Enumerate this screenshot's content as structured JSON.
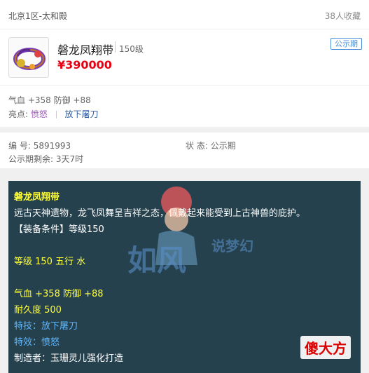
{
  "header": {
    "server": "北京1区-太和殿",
    "favorites": "38人收藏"
  },
  "item": {
    "name": "磐龙凤翔带",
    "level": "150级",
    "price": "¥390000",
    "status_badge": "公示期",
    "attributes": "气血 +358 防御 +88",
    "shine_label": "亮点:",
    "shine_1": "愤怒",
    "shine_2": "放下屠刀"
  },
  "meta": {
    "id_label": "编 号:",
    "id_value": "5891993",
    "status_label": "状 态:",
    "status_value": "公示期",
    "remaining_label": "公示期剩余:",
    "remaining_value": "3天7时"
  },
  "desc": {
    "title": "磐龙凤翔带",
    "flavor": "远古天神遗物，龙飞凤舞呈吉祥之态，佩戴起来能受到上古神兽的庇护。",
    "requirement": "【装备条件】等级150",
    "level_element": "等级 150  五行 水",
    "stats": "气血 +358  防御 +88",
    "durability": "耐久度 500",
    "skill": "特技：放下屠刀",
    "effect": "特效：愤怒",
    "maker": "制造者：玉珊灵儿强化打造"
  },
  "watermark": {
    "text_1": "如风",
    "text_2": "说梦幻"
  },
  "logo": {
    "text": "傻大方"
  },
  "colors": {
    "price": "#e60012",
    "badge": "#4a90d9",
    "panel_bg": "#25414e",
    "desc_yellow": "#ffff33",
    "desc_blue": "#5fb8ff"
  }
}
